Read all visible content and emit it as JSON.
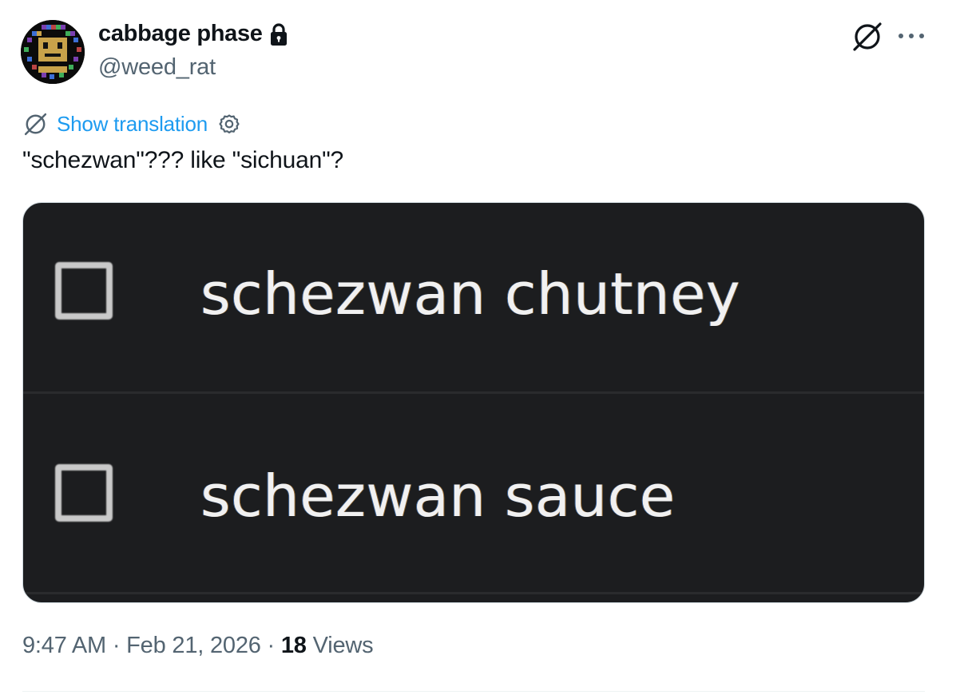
{
  "author": {
    "display_name": "cabbage phase",
    "handle": "@weed_rat",
    "protected": true
  },
  "actions": {
    "grok_icon": "grok-icon",
    "more_icon": "more-icon"
  },
  "translation": {
    "label": "Show translation"
  },
  "tweet": {
    "text": "\"schezwan\"??? like \"sichuan\"?"
  },
  "media": {
    "items": [
      {
        "label": "schezwan chutney",
        "checked": false
      },
      {
        "label": "schezwan sauce",
        "checked": false
      }
    ]
  },
  "meta": {
    "time": "9:47 AM",
    "sep1": " · ",
    "date": "Feb 21, 2026",
    "sep2": " · ",
    "views_count": "18",
    "views_label": " Views"
  },
  "colors": {
    "link": "#1d9bf0",
    "secondary_text": "#536471",
    "primary_text": "#0f1419",
    "media_bg": "#1c1d1f"
  }
}
